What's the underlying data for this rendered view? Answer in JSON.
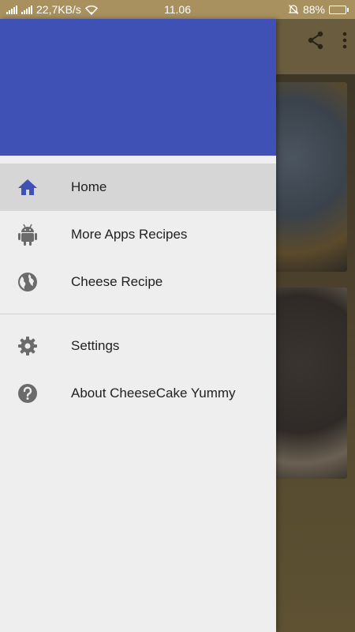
{
  "status_bar": {
    "network_speed": "22,7KB/s",
    "time": "11.06",
    "battery_percent": "88%",
    "battery_level": 0.88
  },
  "background_app": {
    "toolbar_icons": [
      "share-icon",
      "more-vert-icon"
    ]
  },
  "drawer": {
    "header_color": "#3f51b5",
    "items": [
      {
        "label": "Home",
        "icon": "home-icon",
        "active": true
      },
      {
        "label": "More Apps Recipes",
        "icon": "android-icon",
        "active": false
      },
      {
        "label": "Cheese Recipe",
        "icon": "globe-icon",
        "active": false
      }
    ],
    "secondary_items": [
      {
        "label": "Settings",
        "icon": "settings-gear-icon"
      },
      {
        "label": "About CheeseCake Yummy",
        "icon": "help-circle-icon"
      }
    ]
  },
  "colors": {
    "accent": "#3f51b5",
    "active_item_bg": "#d6d6d6",
    "drawer_bg": "#eeeeee",
    "status_bar_bg": "#a8905f"
  }
}
